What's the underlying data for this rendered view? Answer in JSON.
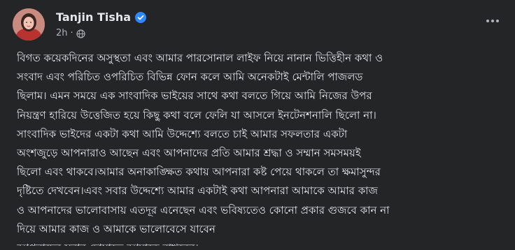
{
  "post": {
    "author": "Tanjin Tisha",
    "timestamp": "2h",
    "separator": "·",
    "verified": true,
    "avatar_icon": "profile-photo",
    "privacy_icon": "globe-icon",
    "menu_icon": "more-horizontal-icon",
    "accent_color": "#2d88ff",
    "lines": [
      "বিগত কয়েকদিনের অসুস্থতা এবং আমার পারসোনাল লাইফ নিয়ে নানান ভিত্তিহীন কথা ও",
      "সংবাদ এবং পরিচিত ওপরিচিত বিভিন্ন ফোন কলে আমি অনেকটাই মেন্টালি পাজলড",
      "ছিলাম। এমন সময়ে এক সাংবাদিক ভাইয়ের সাথে কথা বলতে গিয়ে আমি নিজের উপর",
      "নিয়ন্ত্রণ হারিয়ে উত্তেজিত হয়ে কিছু কথা বলে ফেলি যা আসলে ইনটেনশনালি ছিলো না।",
      "সাংবাদিক ভাইদের একটা কথা আমি উদ্দেশ্যে বলতে চাই আমার সফলতার একটা",
      "অংশজুড়ে আপনারাও আছেন এবং আপনাদের প্রতি আমার শ্রদ্ধা ও সম্মান সমসময়ই",
      "ছিলো এবং থাকবে।আমার অনাকাঙ্ক্ষিত কথায় আপনারা কষ্ট পেয়ে থাকলে তা ক্ষমাসুন্দর",
      "দৃষ্টিতে দেখবেন।এবং সবার উদ্দেশ্যে আমার একটাই কথা আপনারা আমাকে আমার কাজ",
      "ও আপনাদের ভালোবাসায় এতদূর এনেছেন এবং ভবিষ্যতেও কোনো প্রকার গুজবে কান না",
      "দিয়ে আমার কাজ ও আমাকে ভালোবেসে যাবেন",
      "আপনাদের সবার দোয়াতে আমাকে রাখবেন।"
    ]
  }
}
